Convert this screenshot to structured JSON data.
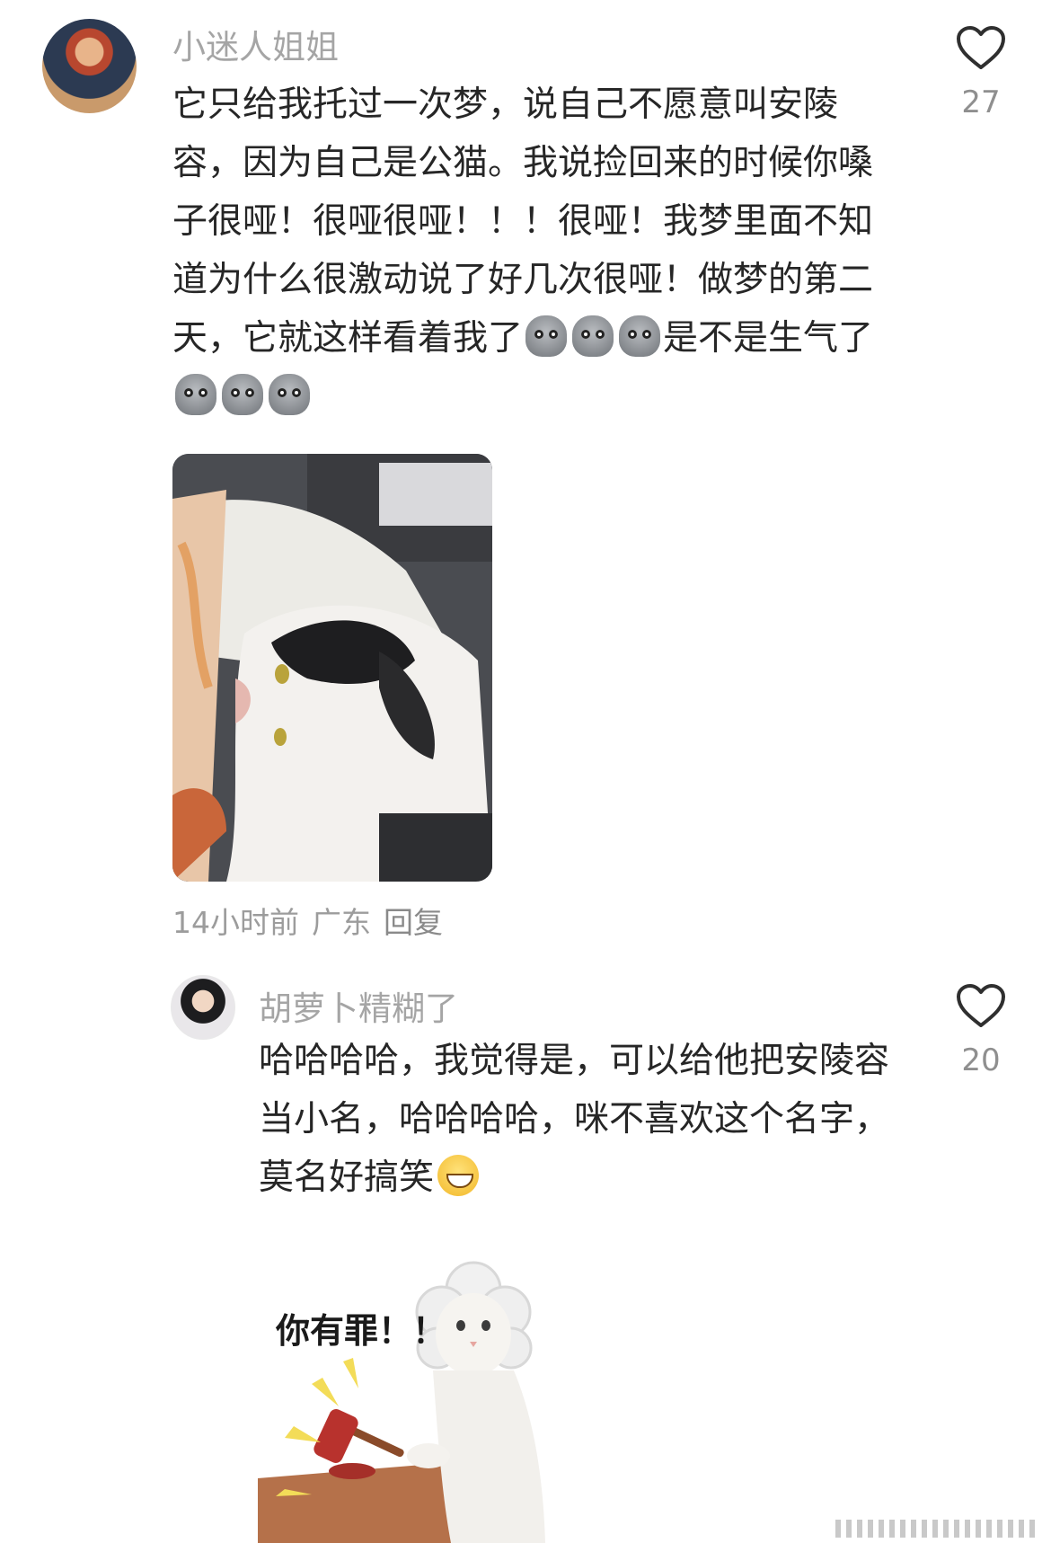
{
  "comment": {
    "username": "小迷人姐姐",
    "text_segments": [
      "它只给我托过一次梦，说自己不愿意叫安陵容，因为自己是公猫。我说捡回来的时候你嗓子很哑！很哑很哑！！！很哑！我梦里面不知道为什么很激动说了好几次很哑！做梦的第二天，它就这样看着我了",
      "是不是生气了"
    ],
    "emoji": "pensive-face-emoji",
    "like_count": "27",
    "time": "14小时前",
    "location": "广东",
    "reply_label": "回复"
  },
  "reply": {
    "username": "胡萝卜精糊了",
    "text": "哈哈哈哈，我觉得是，可以给他把安陵容当小名，哈哈哈哈，咪不喜欢这个名字，莫名好搞笑",
    "emoji": "grinning-squinting-face-emoji",
    "like_count": "20",
    "meme_caption": "你有罪！！"
  },
  "icons": {
    "like": "heart-outline-icon"
  },
  "colors": {
    "username": "#a5a5a5",
    "text": "#262626",
    "meta": "#9c9c9c",
    "like_count": "#8f8f8f"
  }
}
